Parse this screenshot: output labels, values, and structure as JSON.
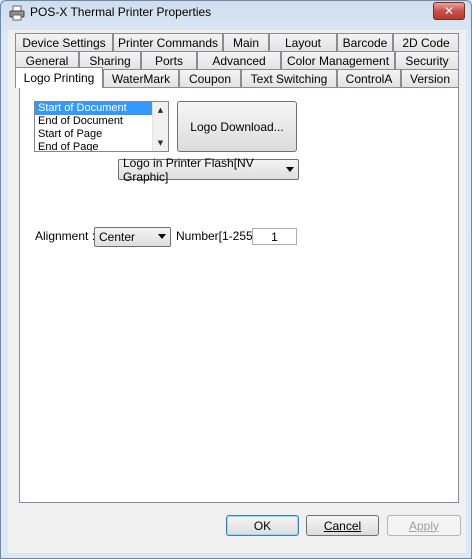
{
  "window": {
    "title": "POS-X Thermal Printer Properties",
    "close_glyph": "✕"
  },
  "tabs": {
    "row1": [
      "Device Settings",
      "Printer Commands",
      "Main",
      "Layout",
      "Barcode",
      "2D Code"
    ],
    "row2": [
      "General",
      "Sharing",
      "Ports",
      "Advanced",
      "Color Management",
      "Security"
    ],
    "row3": [
      "Logo Printing",
      "WaterMark",
      "Coupon",
      "Text Switching",
      "ControlA",
      "Version"
    ],
    "active": "Logo Printing"
  },
  "logo_position_list": {
    "items": [
      "Start of Document",
      "End of Document",
      "Start of Page",
      "End of Page"
    ],
    "selected": "Start of Document"
  },
  "logo_download_button": "Logo Download...",
  "logo_source_select": "Logo in Printer Flash[NV Graphic]",
  "alignment": {
    "label": "Alignment :",
    "value": "Center"
  },
  "number": {
    "label": "Number[1-255]",
    "value": "1"
  },
  "footer": {
    "ok": "OK",
    "cancel": "Cancel",
    "apply": "Apply"
  }
}
